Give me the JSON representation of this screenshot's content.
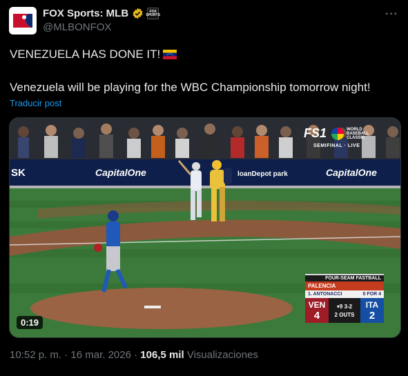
{
  "account": {
    "display_name": "FOX Sports: MLB",
    "handle": "@MLBONFOX",
    "verified_icon": "gold-check",
    "affiliate_badge": "FOX SPORTS"
  },
  "menu_label": "···",
  "tweet": {
    "line1": "VENEZUELA HAS DONE IT!",
    "flag": "venezuela-flag",
    "line2": "Venezuela will be playing for the WBC Championship tomorrow night!",
    "translate": "Traducir post"
  },
  "video": {
    "duration": "0:19",
    "network": "FS1",
    "event": "WORLD BASEBALL CLASSIC",
    "round": "SEMIFINAL · LIVE",
    "ads": [
      "SK",
      "CapitalOne",
      "loanDepot park",
      "CapitalOne"
    ],
    "scorebug": {
      "pitch_type": "FOUR-SEAM FASTBALL",
      "pitcher": "PALENCIA",
      "batter": "1. ANTONACCI",
      "batter_stat": "0 FOR 4",
      "away": "VEN",
      "away_runs": "4",
      "home": "ITA",
      "home_runs": "2",
      "inning": "▾9",
      "count": "3-2",
      "outs": "2 OUTS"
    }
  },
  "meta": {
    "time": "10:52 p. m. · 16 mar. 2026 ·",
    "views": "106,5 mil",
    "views_label": "Visualizaciones"
  },
  "colors": {
    "link": "#1d9bf0",
    "muted": "#71767b",
    "ven": "#9e1c28",
    "ita": "#154fa3"
  }
}
